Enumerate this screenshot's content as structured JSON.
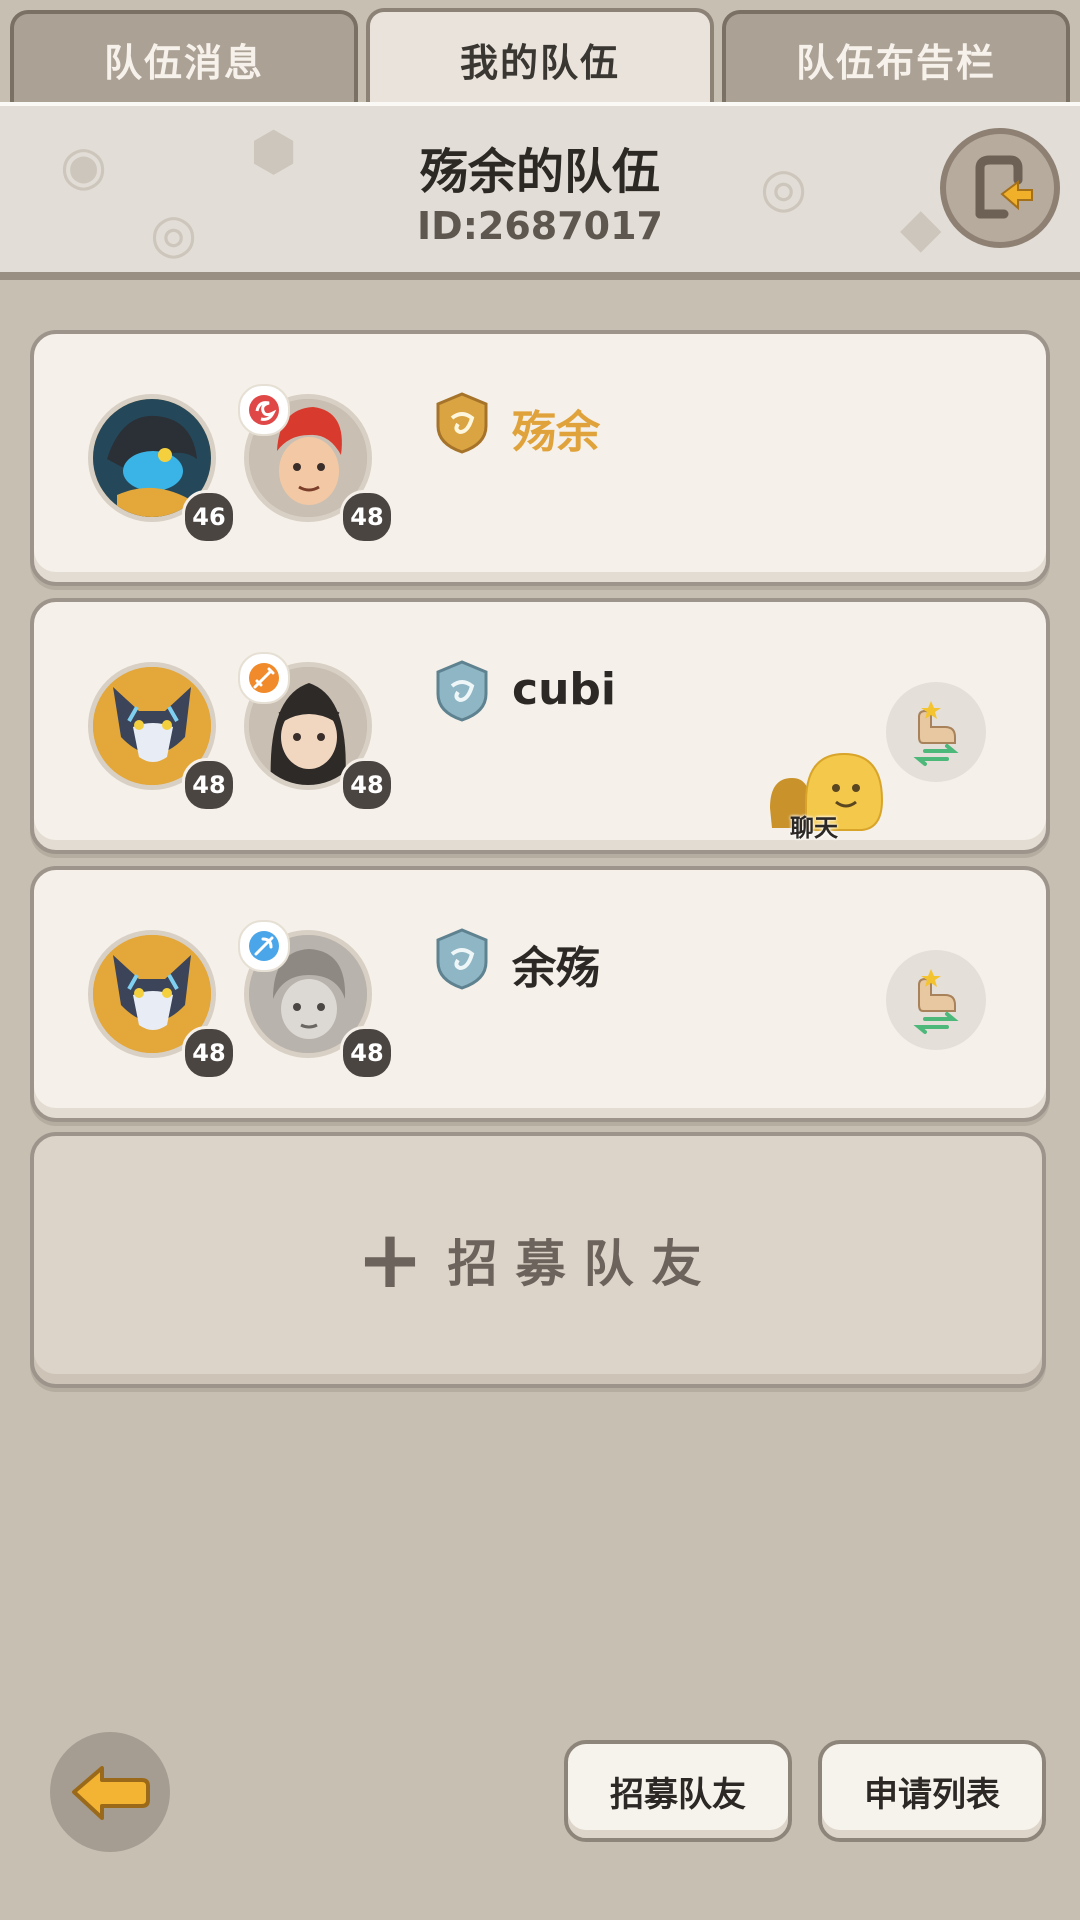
{
  "tabs": [
    {
      "label": "队伍消息",
      "active": false
    },
    {
      "label": "我的队伍",
      "active": true
    },
    {
      "label": "队伍布告栏",
      "active": false
    }
  ],
  "header": {
    "team_name": "殇余的队伍",
    "team_id": "ID:2687017"
  },
  "members": [
    {
      "name": "殇余",
      "role": "leader",
      "pet_level": "46",
      "char_level": "48",
      "shield_color": "#d9a441",
      "class_icon": "fire-swirl-icon",
      "class_color": "#e04848"
    },
    {
      "name": "cubi",
      "role": "member",
      "pet_level": "48",
      "char_level": "48",
      "shield_color": "#8fb6c4",
      "class_icon": "sword-icon",
      "class_color": "#f08a2a",
      "action_icon": "swap-hand-icon"
    },
    {
      "name": "余殇",
      "role": "member",
      "pet_level": "48",
      "char_level": "48",
      "shield_color": "#8fb6c4",
      "class_icon": "magic-icon",
      "class_color": "#4aa6e8",
      "action_icon": "swap-hand-icon"
    }
  ],
  "chat": {
    "label": "聊天"
  },
  "recruit_box": {
    "plus": "+",
    "label": "招募队友"
  },
  "bottom": {
    "recruit_button": "招募队友",
    "apply_list_button": "申请列表"
  },
  "colors": {
    "accent_gold": "#e0a23a",
    "bg": "#c8bfb3"
  }
}
